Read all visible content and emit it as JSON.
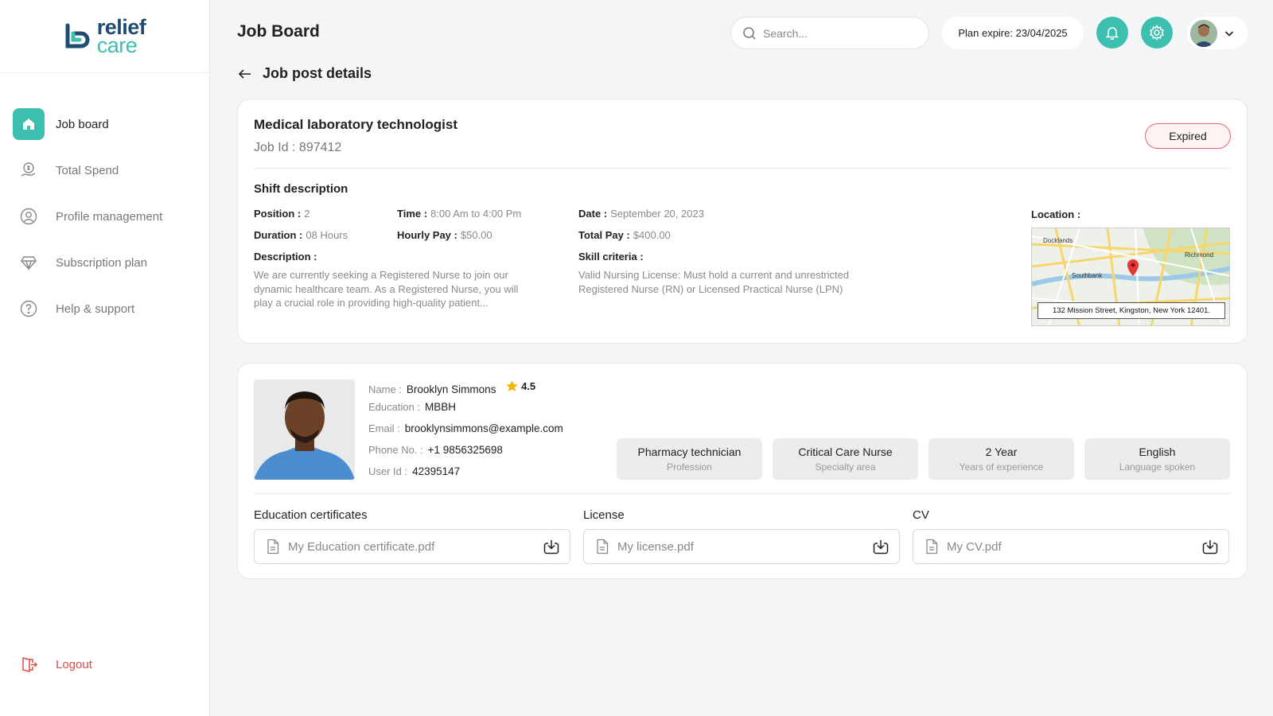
{
  "brand": {
    "line1": "relief",
    "line2": "care"
  },
  "sidebar": {
    "items": [
      {
        "label": "Job board",
        "icon": "home-icon"
      },
      {
        "label": "Total Spend",
        "icon": "money-hand-icon"
      },
      {
        "label": "Profile management",
        "icon": "user-circle-icon"
      },
      {
        "label": "Subscription plan",
        "icon": "diamond-icon"
      },
      {
        "label": "Help & support",
        "icon": "help-icon"
      }
    ],
    "logout": "Logout"
  },
  "header": {
    "title": "Job Board",
    "search_placeholder": "Search...",
    "plan": "Plan expire: 23/04/2025"
  },
  "colors": {
    "accent": "#3cbfae",
    "brand_dark": "#1f4b73",
    "danger": "#e04b4b"
  },
  "page": {
    "back_title": "Job post details"
  },
  "job": {
    "title": "Medical laboratory technologist",
    "job_id": "Job Id : 897412",
    "status": "Expired",
    "shift_heading": "Shift description",
    "position_label": "Position :",
    "position": "2",
    "time_label": "Time :",
    "time": "8:00 Am to 4:00 Pm",
    "date_label": "Date :",
    "date": "September 20, 2023",
    "duration_label": "Duration :",
    "duration": "08 Hours",
    "hourly_label": "Hourly Pay :",
    "hourly": "$50.00",
    "total_label": "Total Pay :",
    "total": "$400.00",
    "description_label": "Description :",
    "description": "We are currently seeking a Registered Nurse to join our dynamic healthcare team. As a Registered Nurse, you will play a crucial role in providing high-quality patient...",
    "skill_label": "Skill criteria :",
    "skill": "Valid Nursing License: Must hold a current and unrestricted Registered Nurse (RN) or Licensed Practical Nurse (LPN)",
    "location_label": "Location :",
    "map": {
      "labels": [
        "Docklands",
        "Richmond",
        "Southbank"
      ],
      "address": "132 Mission Street, Kingston, New York 12401."
    }
  },
  "candidate": {
    "name_label": "Name :",
    "name": "Brooklyn Simmons",
    "rating": "4.5",
    "education_label": "Education :",
    "education": "MBBH",
    "email_label": "Email :",
    "email": "brooklynsimmons@example.com",
    "phone_label": "Phone No. :",
    "phone": "+1 9856325698",
    "userid_label": "User Id :",
    "userid": "42395147",
    "tags": [
      {
        "value": "Pharmacy technician",
        "caption": "Profession"
      },
      {
        "value": "Critical Care Nurse",
        "caption": "Specialty area"
      },
      {
        "value": "2 Year",
        "caption": "Years of experience"
      },
      {
        "value": "English",
        "caption": "Language spoken"
      }
    ],
    "documents": [
      {
        "label": "Education certificates",
        "file": "My Education certificate.pdf"
      },
      {
        "label": "License",
        "file": "My license.pdf"
      },
      {
        "label": "CV",
        "file": "My CV.pdf"
      }
    ]
  }
}
